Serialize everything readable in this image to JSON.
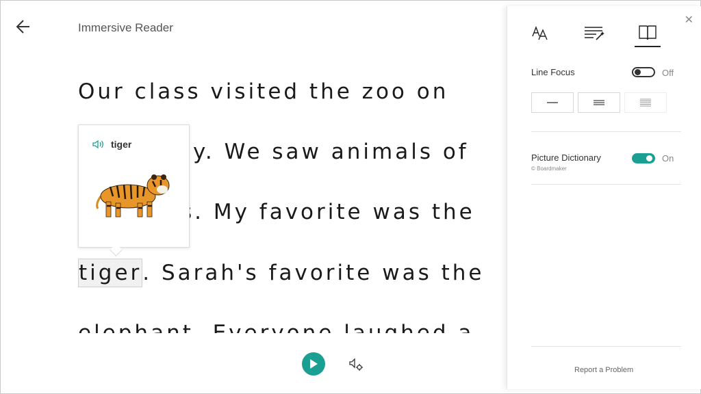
{
  "header": {
    "title": "Immersive Reader",
    "back_icon": "arrow-left-icon"
  },
  "reader": {
    "lines": [
      "Our class visited the zoo on",
      "y. We saw animals of",
      "s. My favorite was the",
      ". Sarah's favorite was the",
      "elephant. Everyone laughed a"
    ],
    "highlighted_word": "tiger"
  },
  "dictionary_popup": {
    "word": "tiger",
    "speaker_icon": "speaker-icon",
    "image": "tiger-illustration"
  },
  "toolbar": {
    "play_icon": "play-icon",
    "voice_settings_icon": "voice-settings-icon"
  },
  "panel": {
    "tabs": [
      {
        "name": "text-preferences",
        "icon": "text-size-icon"
      },
      {
        "name": "grammar-options",
        "icon": "grammar-wand-icon"
      },
      {
        "name": "reading-preferences",
        "icon": "book-icon",
        "active": true
      }
    ],
    "line_focus": {
      "label": "Line Focus",
      "state": "Off",
      "enabled": false
    },
    "picture_dictionary": {
      "label": "Picture Dictionary",
      "credit": "© Boardmaker",
      "state": "On",
      "enabled": true
    },
    "report": "Report a Problem"
  },
  "colors": {
    "accent": "#1a9f92",
    "text": "#1a1a1a"
  }
}
